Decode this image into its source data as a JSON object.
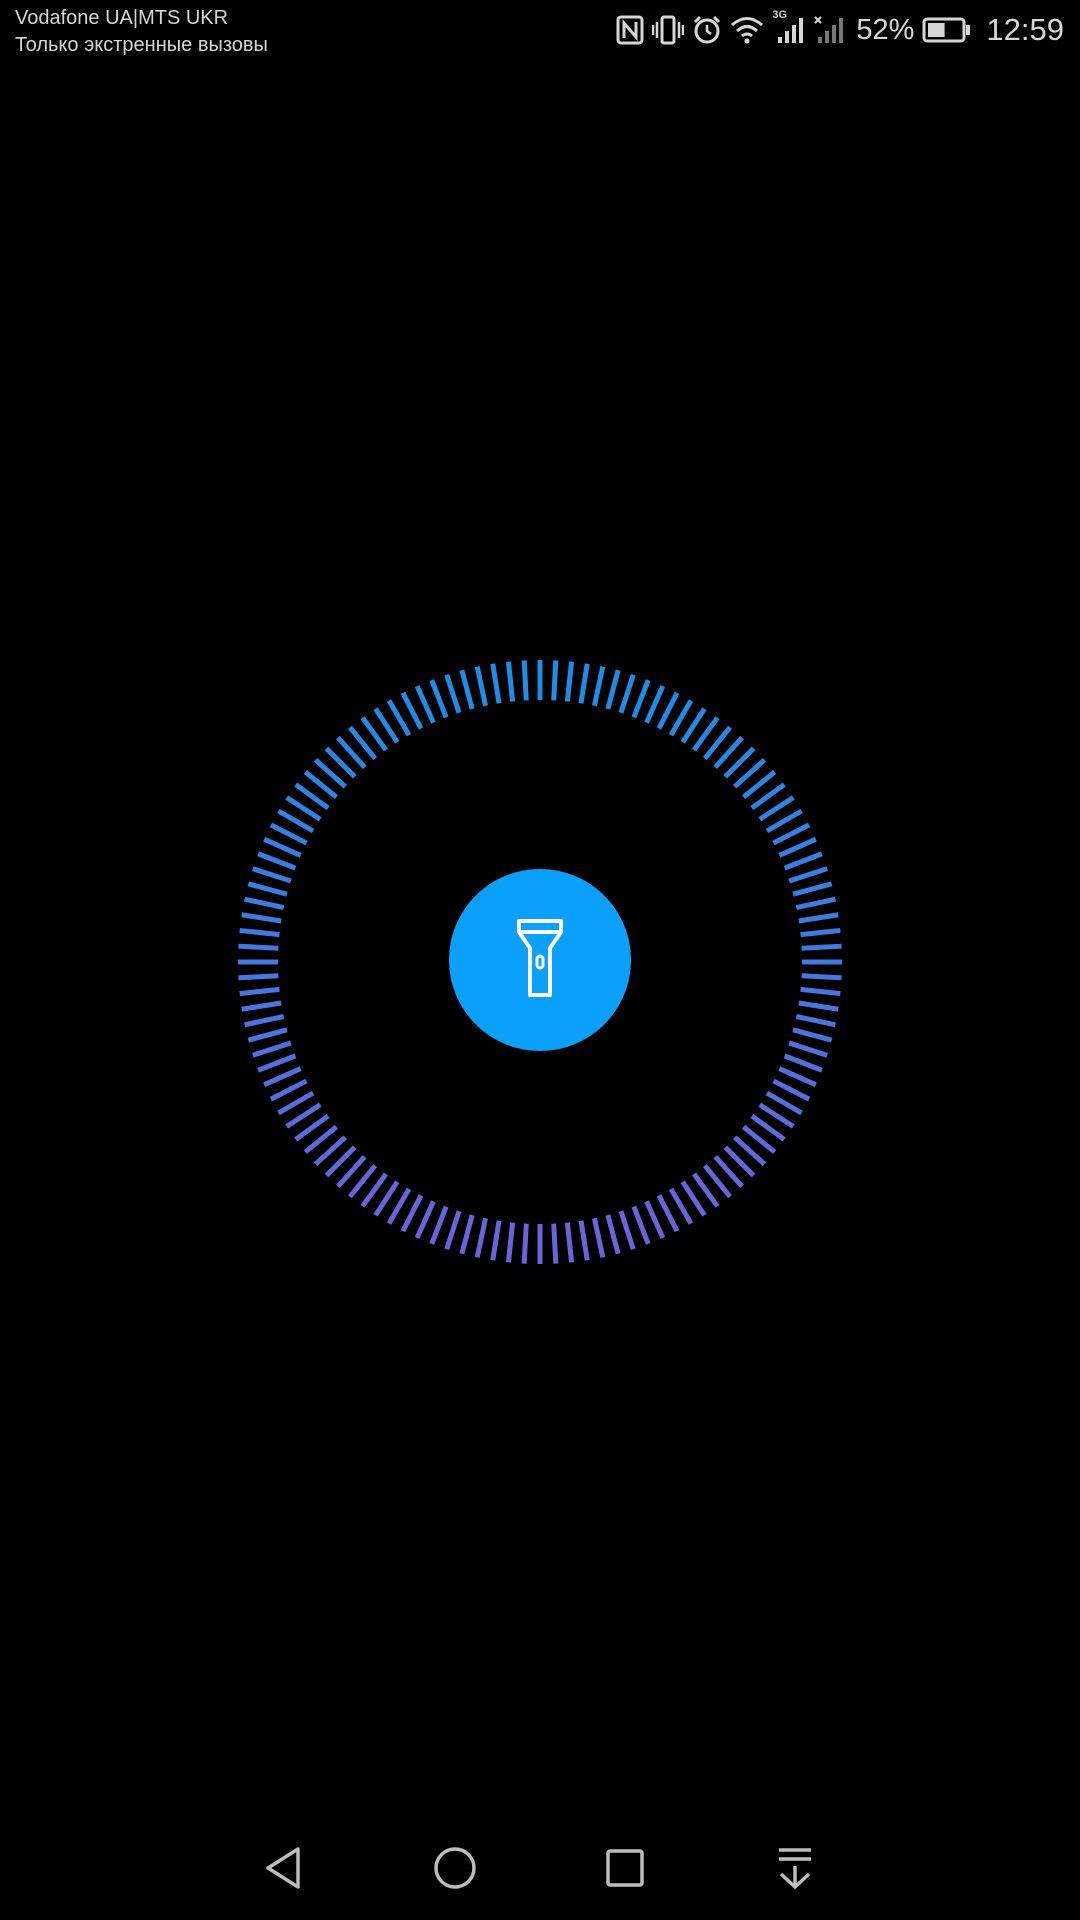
{
  "status_bar": {
    "carrier": "Vodafone UA|MTS UKR",
    "carrier_status": "Только экстренные вызовы",
    "icons": [
      "nfc-icon",
      "vibrate-icon",
      "alarm-icon",
      "wifi-icon",
      "signal-3g-icon",
      "signal-no-sim-icon",
      "battery-icon"
    ],
    "network_type": "3G",
    "battery_percent": "52%",
    "battery_level": 0.52,
    "time": "12:59"
  },
  "flashlight": {
    "icon": "flashlight-icon",
    "state": "off",
    "colors": {
      "button": "#0aa0fb",
      "ring_top": "#1a8fe6",
      "ring_bottom": "#7060d8"
    }
  },
  "nav_bar": {
    "items": [
      "back-icon",
      "home-icon",
      "recents-icon",
      "notifications-pulldown-icon"
    ]
  }
}
